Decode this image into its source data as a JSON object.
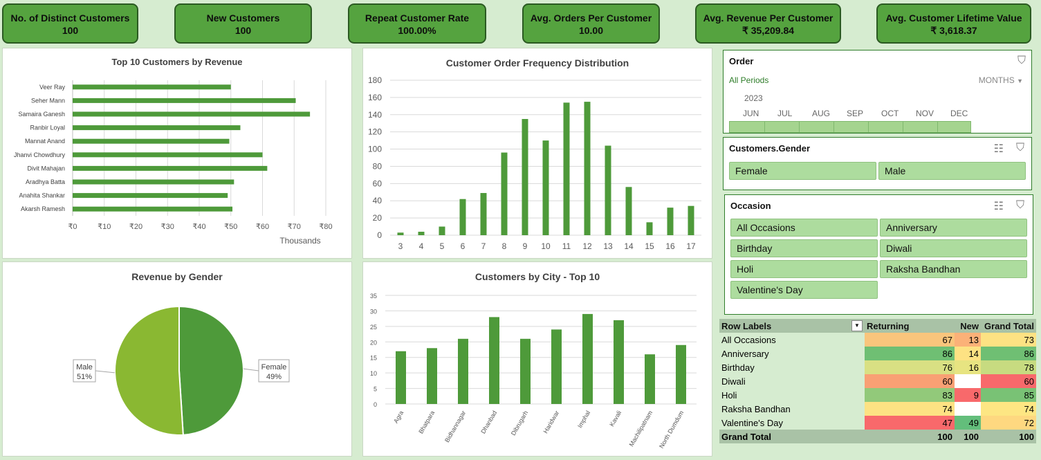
{
  "kpis": [
    {
      "title": "No. of Distinct Customers",
      "value": "100"
    },
    {
      "title": "New Customers",
      "value": "100"
    },
    {
      "title": "Repeat Customer Rate",
      "value": "100.00%"
    },
    {
      "title": "Avg. Orders Per Customer",
      "value": "10.00"
    },
    {
      "title": "Avg. Revenue Per Customer",
      "value": "₹ 35,209.84"
    },
    {
      "title": "Avg. Customer Lifetime Value",
      "value": "₹ 3,618.37"
    }
  ],
  "chart_data": [
    {
      "type": "bar",
      "title": "Top 10 Customers by Revenue",
      "orientation": "horizontal",
      "categories": [
        "Veer Ray",
        "Seher Mann",
        "Samaira Ganesh",
        "Ranbir Loyal",
        "Mannat Anand",
        "Jhanvi Chowdhury",
        "Divit Mahajan",
        "Aradhya Batta",
        "Anahita Shankar",
        "Akarsh Ramesh"
      ],
      "values": [
        50000,
        70500,
        75000,
        53000,
        49500,
        60000,
        61500,
        51000,
        49000,
        50500
      ],
      "ticks": [
        "₹0",
        "₹10",
        "₹20",
        "₹30",
        "₹40",
        "₹50",
        "₹60",
        "₹70",
        "₹80"
      ],
      "xlim": [
        0,
        80000
      ],
      "unit_label": "Thousands",
      "color": "#4e9a3a"
    },
    {
      "type": "bar",
      "title": "Customer Order Frequency Distribution",
      "categories": [
        "3",
        "4",
        "5",
        "6",
        "7",
        "8",
        "9",
        "10",
        "11",
        "12",
        "13",
        "14",
        "15",
        "16",
        "17"
      ],
      "values": [
        3,
        4,
        10,
        42,
        49,
        96,
        135,
        110,
        154,
        155,
        104,
        56,
        15,
        32,
        34
      ],
      "ylim": [
        0,
        180
      ],
      "yticks": [
        "0",
        "20",
        "40",
        "60",
        "80",
        "100",
        "120",
        "140",
        "160",
        "180"
      ],
      "color": "#4e9a3a"
    },
    {
      "type": "pie",
      "title": "Revenue by Gender",
      "slices": [
        {
          "label": "Female",
          "value": 49,
          "text": "Female",
          "pct": "49%",
          "color": "#4e9a3a"
        },
        {
          "label": "Male",
          "value": 51,
          "text": "Male",
          "pct": "51%",
          "color": "#8ab832"
        }
      ]
    },
    {
      "type": "bar",
      "title": "Customers by City - Top 10",
      "categories": [
        "Agra",
        "Bhatpara",
        "Bidhannagar",
        "Dhanbad",
        "Dibrugarh",
        "Haridwar",
        "Imphal",
        "Kavali",
        "Machilipatnam",
        "North Dumdum"
      ],
      "values": [
        17,
        18,
        21,
        28,
        21,
        24,
        29,
        27,
        16,
        19
      ],
      "ylim": [
        0,
        35
      ],
      "yticks": [
        "0",
        "5",
        "10",
        "15",
        "20",
        "25",
        "30",
        "35"
      ],
      "color": "#4e9a3a"
    }
  ],
  "timeline": {
    "title": "Order",
    "selection": "All Periods",
    "level": "MONTHS",
    "year": "2023",
    "months": [
      "JUN",
      "JUL",
      "AUG",
      "SEP",
      "OCT",
      "NOV",
      "DEC"
    ]
  },
  "gender_slicer": {
    "title": "Customers.Gender",
    "items": [
      "Female",
      "Male"
    ]
  },
  "occasion_slicer": {
    "title": "Occasion",
    "items": [
      "All Occasions",
      "Anniversary",
      "Birthday",
      "Diwali",
      "Holi",
      "Raksha Bandhan",
      "Valentine's Day"
    ]
  },
  "pivot": {
    "headers": [
      "Row Labels",
      "Returning",
      "New",
      "Grand Total"
    ],
    "rows": [
      {
        "label": "All Occasions",
        "returning": "67",
        "new": "13",
        "total": "73",
        "colors": [
          "#f9c57c",
          "#fbb178",
          "#fde283"
        ]
      },
      {
        "label": "Anniversary",
        "returning": "86",
        "new": "14",
        "total": "86",
        "colors": [
          "#6fbf73",
          "#fde283",
          "#6fbf73"
        ]
      },
      {
        "label": "Birthday",
        "returning": "76",
        "new": "16",
        "total": "78",
        "colors": [
          "#d9e083",
          "#e7e481",
          "#c7db80"
        ]
      },
      {
        "label": "Diwali",
        "returning": "60",
        "new": "",
        "total": "60",
        "colors": [
          "#f9a074",
          "#ffffff",
          "#f8696b"
        ]
      },
      {
        "label": "Holi",
        "returning": "83",
        "new": "9",
        "total": "85",
        "colors": [
          "#92c97a",
          "#f8696b",
          "#79c275"
        ]
      },
      {
        "label": "Raksha Bandhan",
        "returning": "74",
        "new": "",
        "total": "74",
        "colors": [
          "#fde283",
          "#ffffff",
          "#fde683"
        ]
      },
      {
        "label": "Valentine's Day",
        "returning": "47",
        "new": "49",
        "total": "72",
        "colors": [
          "#f8696b",
          "#63be7b",
          "#fed880"
        ]
      }
    ],
    "grand_total": {
      "label": "Grand Total",
      "returning": "100",
      "new": "100",
      "total": "100"
    }
  }
}
